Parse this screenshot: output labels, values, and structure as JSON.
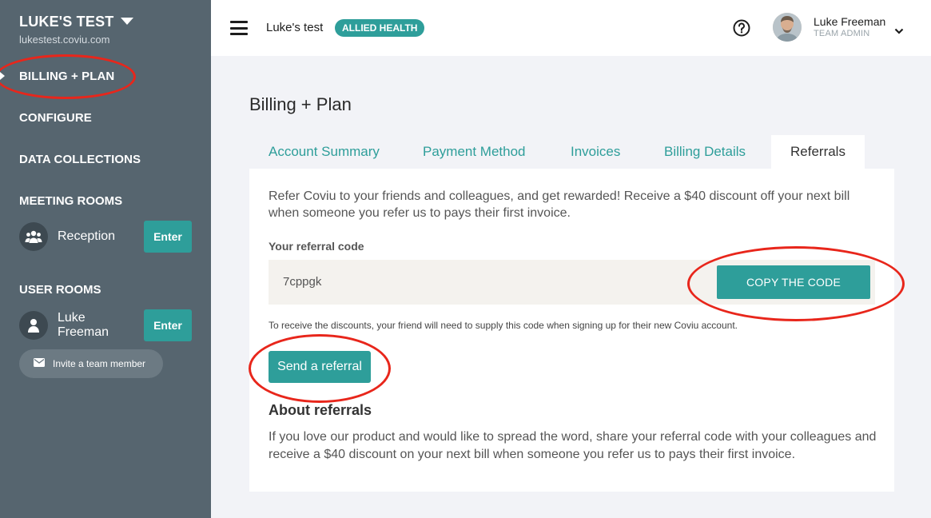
{
  "sidebar": {
    "org_name": "LUKE'S TEST",
    "org_url": "lukestest.coviu.com",
    "nav": [
      "BILLING + PLAN",
      "CONFIGURE",
      "DATA COLLECTIONS"
    ],
    "meeting_rooms_title": "MEETING ROOMS",
    "meeting_rooms": [
      {
        "label": "Reception",
        "button": "Enter",
        "icon": "group-icon"
      }
    ],
    "user_rooms_title": "USER ROOMS",
    "user_rooms": [
      {
        "label_line1": "Luke",
        "label_line2": "Freeman",
        "button": "Enter",
        "icon": "person-icon"
      }
    ],
    "invite_label": "Invite a team member"
  },
  "topbar": {
    "workspace": "Luke's test",
    "badge": "ALLIED HEALTH",
    "user_name": "Luke Freeman",
    "user_role": "TEAM ADMIN"
  },
  "main": {
    "title": "Billing + Plan",
    "tabs": [
      "Account Summary",
      "Payment Method",
      "Invoices",
      "Billing Details",
      "Referrals"
    ],
    "active_tab": "Referrals",
    "intro": "Refer Coviu to your friends and colleagues, and get rewarded! Receive a $40 discount off your next bill when someone you refer us to pays their first invoice.",
    "code_label": "Your referral code",
    "code_value": "7cppgk",
    "copy_button": "COPY THE CODE",
    "hint": "To receive the discounts, your friend will need to supply this code when signing up for their new Coviu account.",
    "send_button": "Send a referral",
    "about_title": "About referrals",
    "about_text": "If you love our product and would like to spread the word, share your referral code with your colleagues and receive a $40 discount on your next bill when someone you refer us to pays their first invoice."
  },
  "colors": {
    "accent": "#2e9e9a",
    "sidebar": "#56656f",
    "annotation": "#e8261b"
  }
}
